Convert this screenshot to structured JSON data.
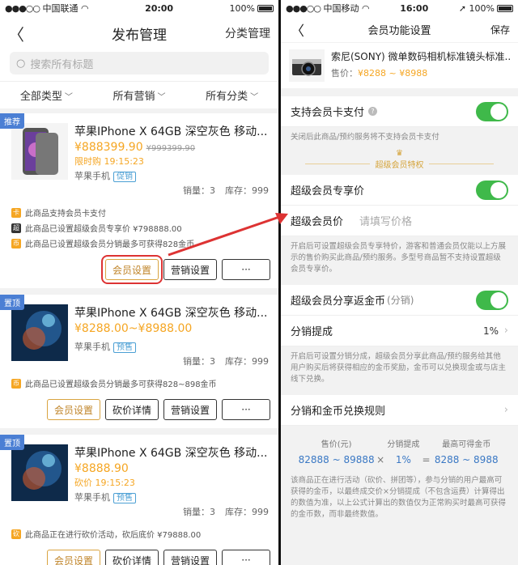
{
  "left": {
    "status": {
      "carrier": "中国联通",
      "time": "20:00",
      "battery": "100%"
    },
    "nav": {
      "title": "发布管理",
      "right": "分类管理"
    },
    "search": {
      "placeholder": "搜索所有标题"
    },
    "filters": [
      "全部类型",
      "所有营销",
      "所有分类"
    ],
    "cards": [
      {
        "tag": "推荐",
        "name": "苹果IPhone X 64GB 深空灰色 移动...",
        "price": "¥888399.90",
        "original_price": "¥999399.90",
        "line3": "限时购 19:15:23",
        "category": "苹果手机",
        "badge": "促销",
        "sales": "销量：3",
        "stock": "库存：999",
        "notes": [
          {
            "icon": "卡",
            "color": "#f5a623",
            "text": "此商品支持会员卡支付"
          },
          {
            "icon": "超",
            "color": "#333333",
            "text": "此商品已设置超级会员专享价 ¥798888.00"
          },
          {
            "icon": "币",
            "color": "#f5a623",
            "text": "此商品已设置超级会员分销最多可获得828金币"
          }
        ],
        "buttons": [
          "会员设置",
          "营销设置",
          "···"
        ]
      },
      {
        "tag": "置顶",
        "name": "苹果IPhone X 64GB 深空灰色 移动...",
        "price": "¥8288.00~¥8988.00",
        "category": "苹果手机",
        "badge": "预售",
        "sales": "销量：3",
        "stock": "库存：999",
        "notes": [
          {
            "icon": "币",
            "color": "#f5a623",
            "text": "此商品已设置超级会员分销最多可获得828~898金币"
          }
        ],
        "buttons": [
          "会员设置",
          "砍价详情",
          "营销设置",
          "···"
        ]
      },
      {
        "tag": "置顶",
        "name": "苹果IPhone X 64GB 深空灰色 移动...",
        "price": "¥8888.90",
        "line3": "砍价 19:15:23",
        "category": "苹果手机",
        "badge": "预售",
        "sales": "销量：3",
        "stock": "库存：999",
        "notes": [
          {
            "icon": "砍",
            "color": "#f5a623",
            "text": "此商品正在进行砍价活动，砍后底价 ¥79888.00"
          }
        ],
        "buttons": [
          "会员设置",
          "砍价详情",
          "营销设置",
          "···"
        ]
      }
    ]
  },
  "right": {
    "status": {
      "carrier": "中国移动",
      "time": "16:00",
      "battery": "100%"
    },
    "nav": {
      "title": "会员功能设置",
      "save": "保存"
    },
    "product": {
      "name": "索尼(SONY) 微单数码相机标准镜头标准...",
      "price_label": "售价：",
      "price": "¥8288 ~ ¥8988"
    },
    "card_pay": {
      "label": "支持会员卡支付",
      "hint": "关闭后此商品/预约服务将不支持会员卡支付"
    },
    "section_title": "超级会员特权",
    "exclusive": {
      "label": "超级会员专享价",
      "price_label": "超级会员价",
      "placeholder": "请填写价格",
      "hint": "开启后可设置超级会员专享特价，游客和普通会员仅能以上方展示的售价购买此商品/预约服务。多型号商品暂不支持设置超级会员专享价。"
    },
    "share": {
      "label": "超级会员分享返金币",
      "label_suffix": "(分销)",
      "commission_label": "分销提成",
      "commission_value": "1%",
      "hint": "开启后可设置分销分成，超级会员分享此商品/预约服务给其他用户购买后将获得相应的金币奖励，金币可以兑换现金或与店主线下兑换。"
    },
    "rules": {
      "label": "分销和金币兑换规则"
    },
    "formula": {
      "headers": [
        "售价(元)",
        "分销提成",
        "最高可得金币"
      ],
      "values": [
        "82888 ~ 89888",
        "×",
        "1%",
        "=",
        "8288 ~ 8988"
      ],
      "hint": "该商品正在进行活动（砍价、拼团等），参与分销的用户最高可获得的金币，以最终成交价×分销提成（不包含运费）计算得出的数值为准，以上公式计算出的数值仅为正常购买时最高可获得的金币数，而非最终数值。"
    }
  }
}
